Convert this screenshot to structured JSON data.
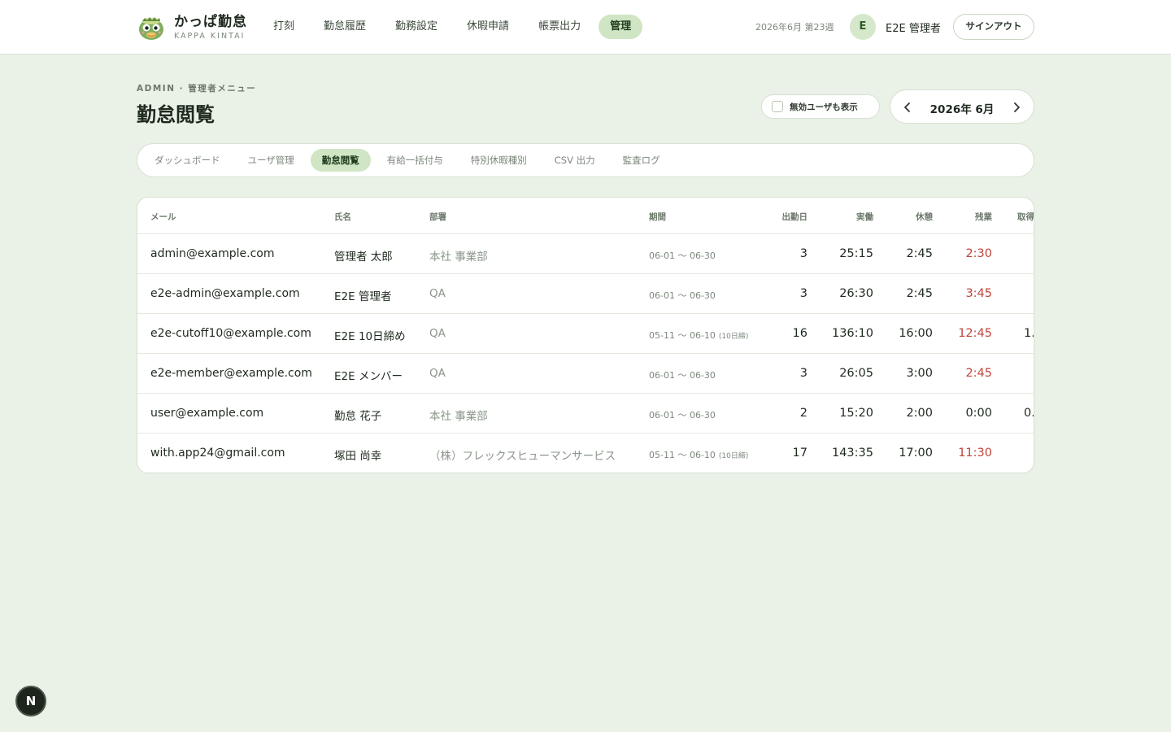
{
  "header": {
    "brand_name": "かっぱ勤怠",
    "brand_sub": "KAPPA KINTAI",
    "nav": [
      {
        "label": "打刻"
      },
      {
        "label": "勤怠履歴"
      },
      {
        "label": "勤務設定"
      },
      {
        "label": "休暇申請"
      },
      {
        "label": "帳票出力"
      },
      {
        "label": "管理"
      }
    ],
    "week_label": "2026年6月 第23週",
    "avatar_initial": "E",
    "user_name": "E2E 管理者",
    "signout_label": "サインアウト"
  },
  "page": {
    "eyebrow": "ADMIN · 管理者メニュー",
    "title": "勤怠閲覧",
    "show_inactive_label": "無効ユーザも表示",
    "show_inactive_checked": false,
    "month_label": "2026年 6月"
  },
  "tabs": [
    {
      "label": "ダッシュボード"
    },
    {
      "label": "ユーザ管理"
    },
    {
      "label": "勤怠閲覧"
    },
    {
      "label": "有給一括付与"
    },
    {
      "label": "特別休暇種別"
    },
    {
      "label": "CSV 出力"
    },
    {
      "label": "監査ログ"
    }
  ],
  "table": {
    "columns": {
      "email": "メール",
      "name": "氏名",
      "dept": "部署",
      "period": "期間",
      "days": "出勤日",
      "work": "実働",
      "break": "休憩",
      "overtime": "残業",
      "acquired": "取得"
    },
    "rows": [
      {
        "email": "admin@example.com",
        "name": "管理者 太郎",
        "dept": "本社 事業部",
        "period": "06-01 〜 06-30",
        "cutoff": "",
        "days": "3",
        "work": "25:15",
        "break": "2:45",
        "overtime": "2:30",
        "overtime_alert": true,
        "acquired": ""
      },
      {
        "email": "e2e-admin@example.com",
        "name": "E2E 管理者",
        "dept": "QA",
        "period": "06-01 〜 06-30",
        "cutoff": "",
        "days": "3",
        "work": "26:30",
        "break": "2:45",
        "overtime": "3:45",
        "overtime_alert": true,
        "acquired": ""
      },
      {
        "email": "e2e-cutoff10@example.com",
        "name": "E2E 10日締め",
        "dept": "QA",
        "period": "05-11 〜 06-10",
        "cutoff": "(10日締)",
        "days": "16",
        "work": "136:10",
        "break": "16:00",
        "overtime": "12:45",
        "overtime_alert": true,
        "acquired": "1."
      },
      {
        "email": "e2e-member@example.com",
        "name": "E2E メンバー",
        "dept": "QA",
        "period": "06-01 〜 06-30",
        "cutoff": "",
        "days": "3",
        "work": "26:05",
        "break": "3:00",
        "overtime": "2:45",
        "overtime_alert": true,
        "acquired": ""
      },
      {
        "email": "user@example.com",
        "name": "勤怠 花子",
        "dept": "本社 事業部",
        "period": "06-01 〜 06-30",
        "cutoff": "",
        "days": "2",
        "work": "15:20",
        "break": "2:00",
        "overtime": "0:00",
        "overtime_alert": false,
        "acquired": "0."
      },
      {
        "email": "with.app24@gmail.com",
        "name": "塚田 尚幸",
        "dept": "（株）フレックスヒューマンサービス",
        "period": "05-11 〜 06-10",
        "cutoff": "(10日締)",
        "days": "17",
        "work": "143:35",
        "break": "17:00",
        "overtime": "11:30",
        "overtime_alert": true,
        "acquired": ""
      }
    ]
  },
  "dev_badge": "N",
  "colors": {
    "background": "#eaf1e6",
    "accent": "#cfe5c4",
    "overtime_alert": "#c0443b"
  },
  "icons": {
    "logo": "kappa-logo-icon",
    "prev": "chevron-left-icon",
    "next": "chevron-right-icon"
  }
}
